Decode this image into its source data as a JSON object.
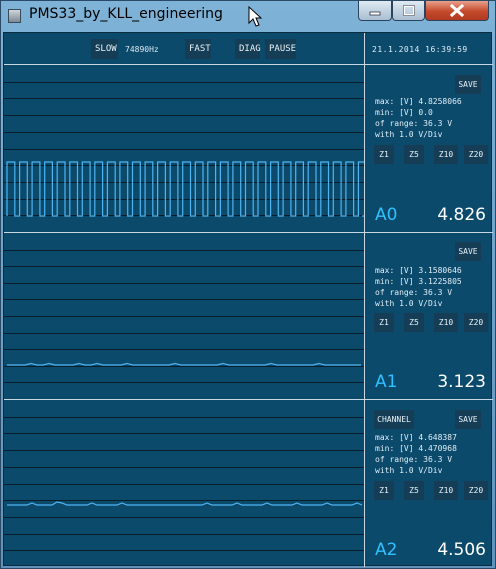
{
  "window": {
    "title": "PMS33_by_KLL_engineering"
  },
  "toolbar": {
    "slow_label": "SLOW",
    "frequency": "74890Hz",
    "fast_label": "FAST",
    "diag_label": "DIAG",
    "pause_label": "PAUSE",
    "datetime": "21.1.2014 16:39:59"
  },
  "channels": [
    {
      "name": "A0",
      "value": "4.826",
      "max_text": "max: [V]  4.8258066",
      "min_text": "min: [V]  0.0",
      "range_text": "of range: 36.3 V",
      "scale_text": "with 1.0 V/Div",
      "save_label": "SAVE",
      "zoom": [
        "Z1",
        "Z5",
        "Z10",
        "Z20"
      ]
    },
    {
      "name": "A1",
      "value": "3.123",
      "max_text": "max: [V]  3.1580646",
      "min_text": "min: [V]  3.1225805",
      "range_text": "of range: 36.3 V",
      "scale_text": "with 1.0 V/Div",
      "save_label": "SAVE",
      "zoom": [
        "Z1",
        "Z5",
        "Z10",
        "Z20"
      ]
    },
    {
      "name": "A2",
      "value": "4.506",
      "max_text": "max: [V]  4.648387",
      "min_text": "min: [V]  4.470968",
      "range_text": "of range: 36.3 V",
      "scale_text": "with 1.0 V/Div",
      "save_label": "SAVE",
      "channel_label": "CHANNEL",
      "zoom": [
        "Z1",
        "Z5",
        "Z10",
        "Z20"
      ]
    }
  ],
  "colors": {
    "background": "#0c4a6c",
    "trace": "#4fb4f0",
    "grid": "#0a1e2c",
    "channel_name": "#2fc0ff"
  }
}
